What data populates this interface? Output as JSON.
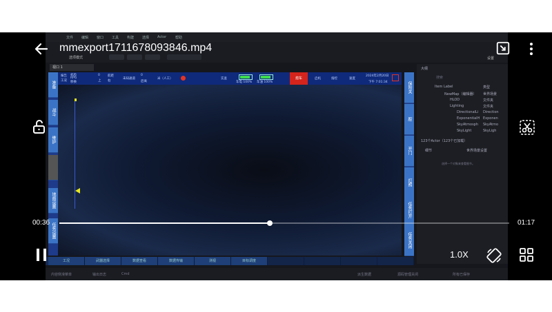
{
  "video": {
    "title": "mmexport1711678093846.mp4",
    "current_time": "00:36",
    "total_time": "01:17",
    "progress": 0.468,
    "speed": "1.0X"
  },
  "editor": {
    "menu": [
      "文件",
      "编辑",
      "窗口",
      "工具",
      "构建",
      "选择",
      "Actor",
      "帮助"
    ],
    "mode_label": "选项模式",
    "window_btn": "设置",
    "viewport_tab": "视口 1",
    "hud": {
      "labels": [
        "报告",
        "工况",
        "机检",
        "RPG",
        "移换",
        "0",
        "上",
        "0",
        "航距",
        "右",
        "未知通道",
        "0",
        "后离",
        "米（人工）",
        "实查",
        "车电 100%",
        "车油 100%",
        "熄车",
        "启机",
        "熔控",
        "速度",
        "2024年2月20日",
        "下午 7:01:34"
      ],
      "alert_button": "熄车",
      "battery1": 1.0,
      "battery2": 1.0
    },
    "left_buttons": [
      "准备",
      "战斗",
      "维护",
      "",
      "地图设置",
      "任务设置"
    ],
    "right_buttons": [
      "保险关",
      "腔",
      "开门",
      "灯照",
      "任务打开",
      "任务关闭"
    ],
    "bottom_tabs": [
      "工况",
      "武器选择",
      "数据查看",
      "数据传输",
      "测视",
      "目标调度",
      "",
      "",
      "",
      ""
    ],
    "outliner": {
      "title": "大纲",
      "search_placeholder": "搜索",
      "col_label": "Item Label",
      "col_type": "类型",
      "rows": [
        {
          "label": "NewMap（编辑器）",
          "type": "世界场景"
        },
        {
          "label": "HLOD",
          "type": "文件夹"
        },
        {
          "label": "Lighting",
          "type": "文件夹"
        },
        {
          "label": "DirectionalLi",
          "type": "Direction"
        },
        {
          "label": "ExponentialH",
          "type": "Exponen"
        },
        {
          "label": "SkyAtmosph",
          "type": "SkyAtmo"
        },
        {
          "label": "SkyLight",
          "type": "SkyLigh"
        }
      ],
      "count_text": "123个Actor（123个已加载）",
      "details_tab": "细节",
      "world_tab": "世界场景设置",
      "hint": "选择一个对象来查看细节。"
    },
    "status": [
      "内容侧滑菜单",
      "输出日志",
      "Cmd",
      "派生数据",
      "源码管理关闭",
      "所有已保存"
    ]
  },
  "colors": {
    "hud_blue": "#0f2a7a",
    "button_blue": "#3b74c6",
    "alert_red": "#d4241c",
    "battery_green": "#3dde4c"
  },
  "icons": [
    "back-arrow-icon",
    "lock-icon",
    "pip-icon",
    "more-icon",
    "cut-icon",
    "pause-icon",
    "rotate-icon",
    "grid-icon"
  ]
}
